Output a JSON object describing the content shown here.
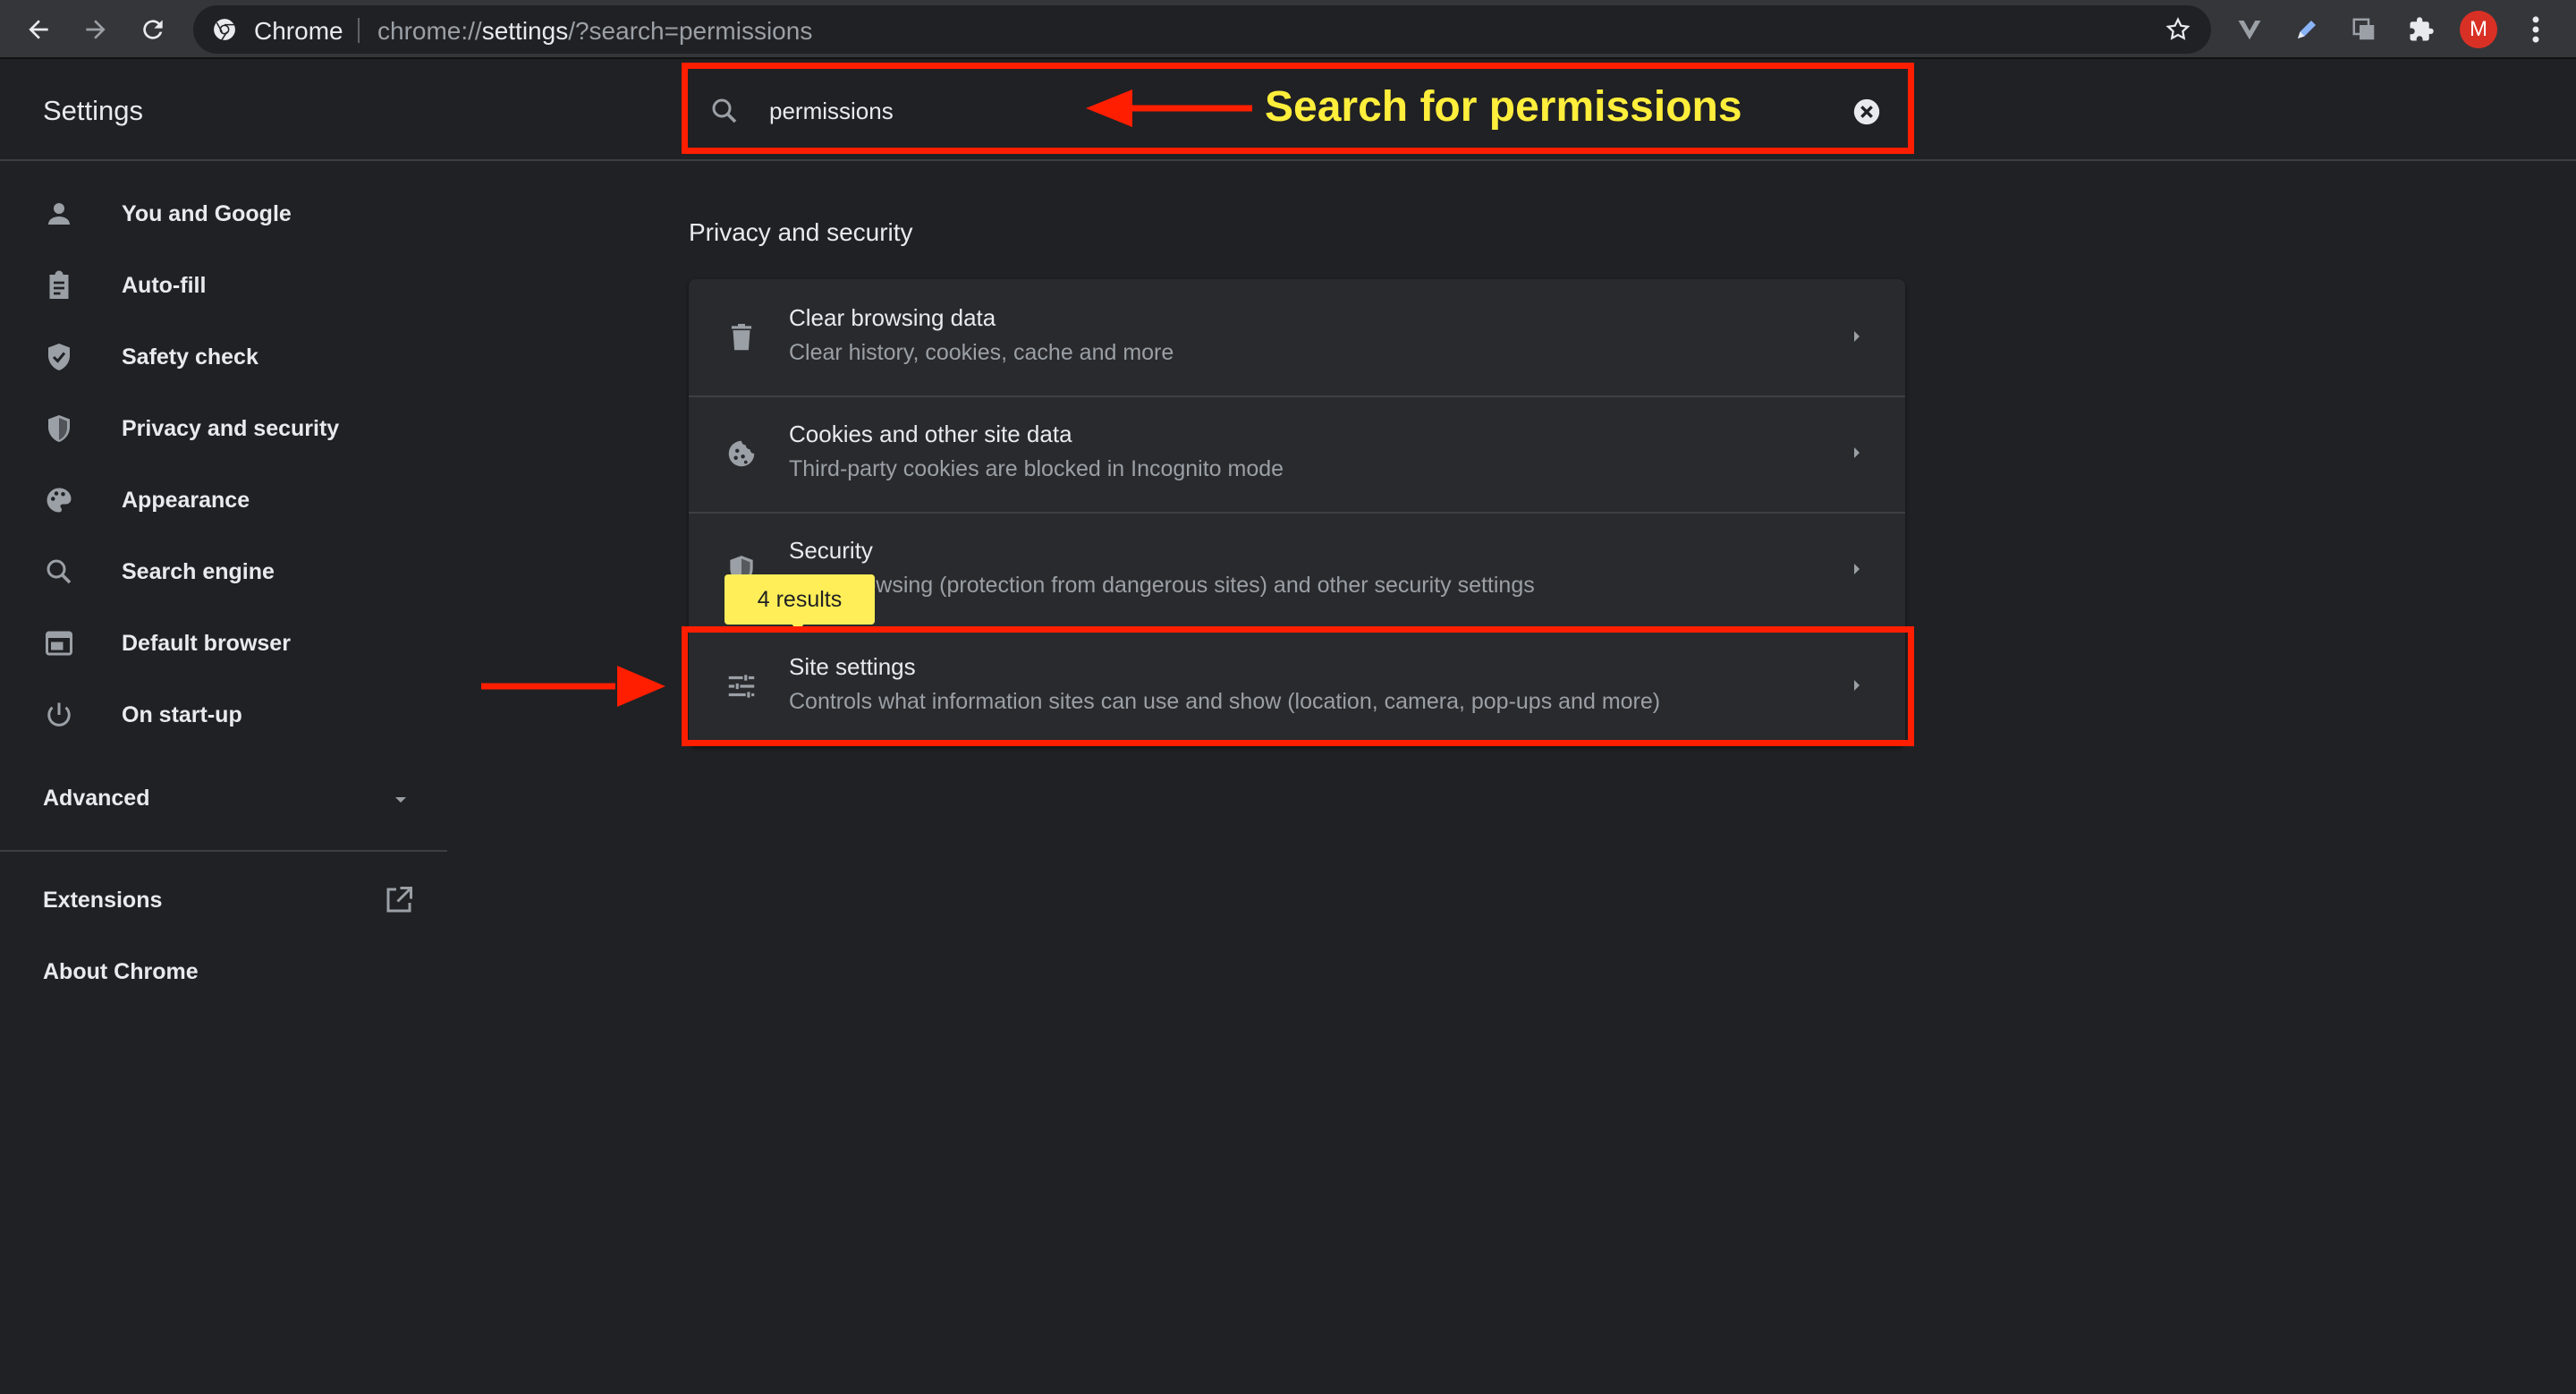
{
  "browser": {
    "site_name": "Chrome",
    "url_scheme": "chrome://",
    "url_host": "settings",
    "url_rest": "/?search=permissions",
    "profile_initial": "M",
    "profile_color": "#d93025"
  },
  "header": {
    "title": "Settings",
    "search_value": "permissions"
  },
  "sidebar": {
    "items": [
      {
        "label": "You and Google",
        "icon": "person-icon"
      },
      {
        "label": "Auto-fill",
        "icon": "clipboard-icon"
      },
      {
        "label": "Safety check",
        "icon": "shield-check-icon"
      },
      {
        "label": "Privacy and security",
        "icon": "shield-half-icon"
      },
      {
        "label": "Appearance",
        "icon": "palette-icon"
      },
      {
        "label": "Search engine",
        "icon": "search-icon"
      },
      {
        "label": "Default browser",
        "icon": "browser-window-icon"
      },
      {
        "label": "On start-up",
        "icon": "power-icon"
      }
    ],
    "advanced_label": "Advanced",
    "extensions_label": "Extensions",
    "about_label": "About Chrome"
  },
  "main": {
    "section_title": "Privacy and security",
    "rows": [
      {
        "title": "Clear browsing data",
        "subtitle": "Clear history, cookies, cache and more",
        "icon": "trash-icon"
      },
      {
        "title": "Cookies and other site data",
        "subtitle": "Third-party cookies are blocked in Incognito mode",
        "icon": "cookie-icon"
      },
      {
        "title": "Security",
        "subtitle": "Safe Browsing (protection from dangerous sites) and other security settings",
        "subtitle_visible": "wsing (protection from dangerous sites) and other security settings",
        "icon": "shield-half-icon"
      },
      {
        "title": "Site settings",
        "subtitle": "Controls what information sites can use and show (location, camera, pop-ups and more)",
        "icon": "tune-icon"
      }
    ],
    "results_bubble": "4 results"
  },
  "annotations": {
    "search_callout": "Search for permissions",
    "highlight_color": "#ff1e00",
    "callout_color": "#ffee3b"
  }
}
